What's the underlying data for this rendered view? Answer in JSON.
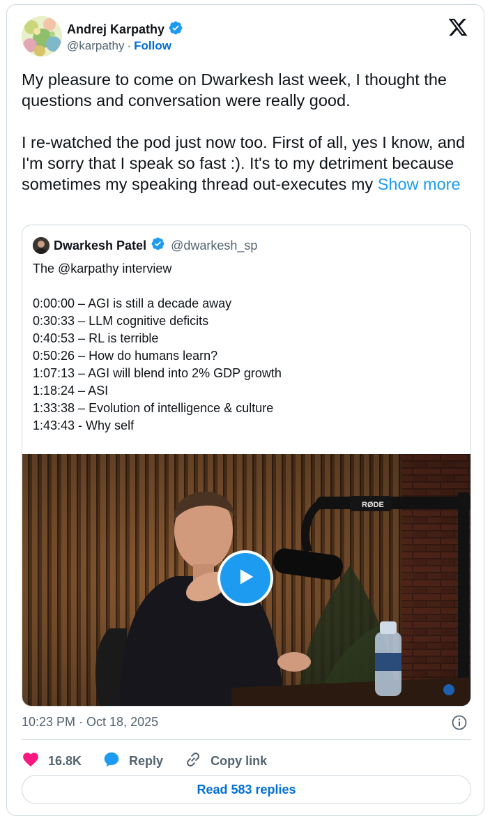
{
  "author": {
    "name": "Andrej Karpathy",
    "handle": "@karpathy",
    "separator": "·",
    "follow_label": "Follow"
  },
  "tweet": {
    "text": "My pleasure to come on Dwarkesh last week, I thought the questions and conversation were really good.\n\nI re-watched the pod just now too. First of all, yes I know, and I'm sorry that I speak so fast :). It's to my detriment because sometimes my speaking thread out-executes my ",
    "show_more": "Show more"
  },
  "quote": {
    "name": "Dwarkesh Patel",
    "handle": "@dwarkesh_sp",
    "lines": [
      "The @karpathy interview",
      "",
      "0:00:00 – AGI is still a decade away",
      "0:30:33 – LLM cognitive deficits",
      "0:40:53 – RL is terrible",
      "0:50:26 – How do humans learn?",
      "1:07:13 – AGI will blend into 2% GDP growth",
      "1:18:24 – ASI",
      "1:33:38 – Evolution of intelligence & culture",
      "1:43:43 - Why self"
    ],
    "mic_brand": "RØDE"
  },
  "footer": {
    "timestamp": "10:23 PM · Oct 18, 2025",
    "likes": "16.8K",
    "reply_label": "Reply",
    "copy_link_label": "Copy link",
    "read_replies": "Read 583 replies"
  },
  "colors": {
    "accent": "#1d9bf0",
    "link": "#006fd6",
    "heart": "#f91880",
    "verified": "#1d9bf0"
  },
  "icons": [
    "x-logo-icon",
    "verified-badge-icon",
    "play-icon",
    "info-icon",
    "heart-icon",
    "reply-icon",
    "link-icon"
  ]
}
